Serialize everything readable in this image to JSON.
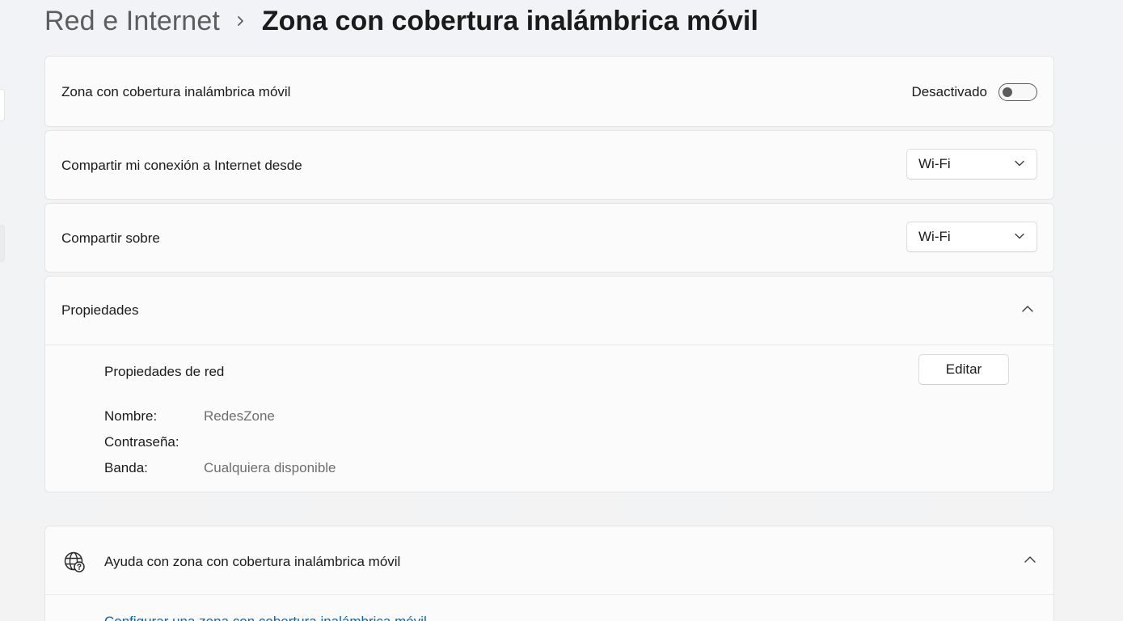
{
  "breadcrumb": {
    "parent": "Red e Internet",
    "current": "Zona con cobertura inalámbrica móvil"
  },
  "hotspot": {
    "label": "Zona con cobertura inalámbrica móvil",
    "state_text": "Desactivado",
    "enabled": false
  },
  "share_from": {
    "label": "Compartir mi conexión a Internet desde",
    "value": "Wi-Fi"
  },
  "share_over": {
    "label": "Compartir sobre",
    "value": "Wi-Fi"
  },
  "properties": {
    "header": "Propiedades",
    "network_title": "Propiedades de red",
    "edit_label": "Editar",
    "fields": [
      {
        "label": "Nombre:",
        "value": "RedesZone"
      },
      {
        "label": "Contraseña:",
        "value": ""
      },
      {
        "label": "Banda:",
        "value": "Cualquiera disponible"
      }
    ]
  },
  "help": {
    "header": "Ayuda con zona con cobertura inalámbrica móvil",
    "link_text": "Configurar una zona con cobertura inalámbrica móvil"
  },
  "colors": {
    "accent_link": "#0067c0",
    "background": "#f3f3f3",
    "card": "#fbfbfb"
  }
}
